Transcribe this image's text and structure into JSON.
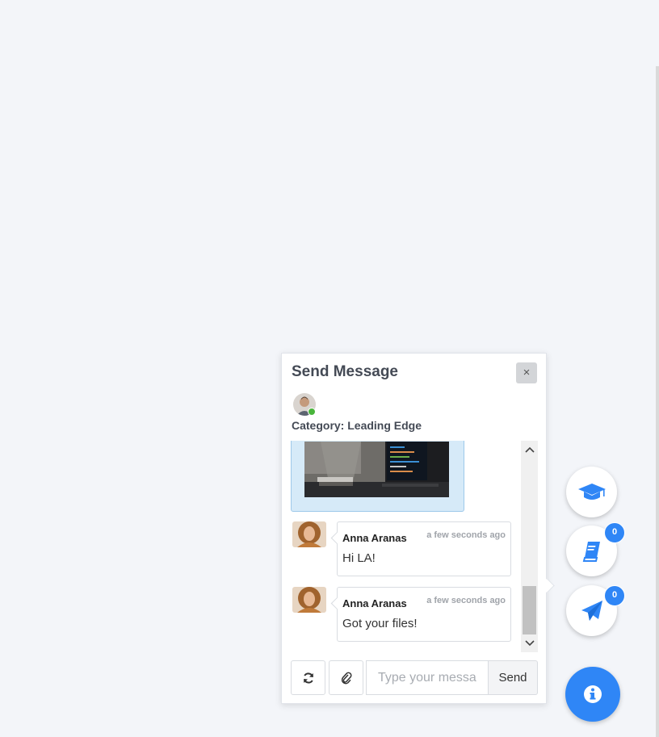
{
  "chat": {
    "title": "Send Message",
    "close_label": "×",
    "category": "Category: Leading Edge",
    "messages": [
      {
        "author": "Anna Aranas",
        "time": "a few seconds ago",
        "text": "Hi LA!"
      },
      {
        "author": "Anna Aranas",
        "time": "a few seconds ago",
        "text": "Got your files!"
      }
    ],
    "input_placeholder": "Type your message",
    "send_label": "Send",
    "scroll_up": "⌃",
    "scroll_down": "⌄"
  },
  "fabs": {
    "books_count": "0",
    "messages_count": "0"
  },
  "colors": {
    "accent": "#2f86f6",
    "online": "#49b53b"
  },
  "icons": [
    "close-icon",
    "refresh-icon",
    "paperclip-icon",
    "graduation-cap-icon",
    "book-icon",
    "paper-plane-icon",
    "info-icon"
  ]
}
